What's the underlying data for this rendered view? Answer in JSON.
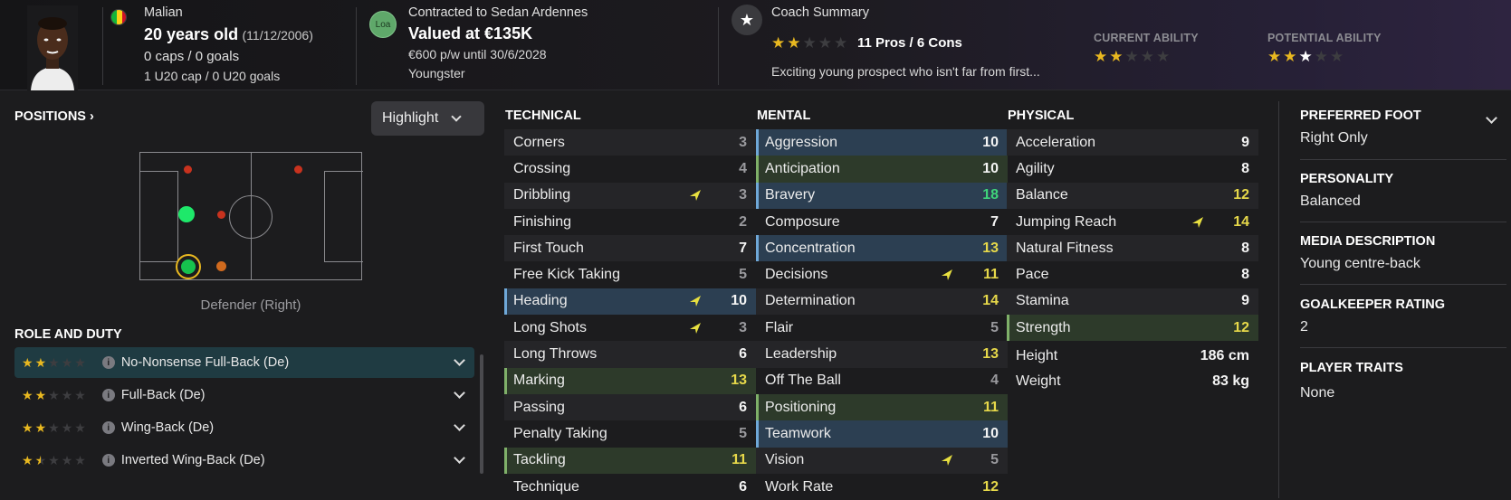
{
  "player": {
    "nationality": "Malian",
    "age": "20 years old",
    "dob": "(11/12/2006)",
    "caps": "0 caps / 0 goals",
    "u20": "1 U20 cap / 0 U20 goals"
  },
  "contract": {
    "club_badge": "Loa",
    "contracted_to": "Contracted to Sedan Ardennes",
    "value": "Valued at €135K",
    "wage": "€600 p/w until 30/6/2028",
    "status": "Youngster"
  },
  "coach": {
    "title": "Coach Summary",
    "pros_cons": "11 Pros / 6 Cons",
    "summary": "Exciting young prospect who isn't far from first...",
    "rating_stars": 2,
    "current_ability_label": "CURRENT ABILITY",
    "current_ability_stars": 2,
    "potential_ability_label": "POTENTIAL ABILITY",
    "potential_ability_stars": 3
  },
  "positions": {
    "title": "POSITIONS",
    "highlight_label": "Highlight",
    "position_name": "Defender (Right)"
  },
  "roles": {
    "title": "ROLE AND DUTY",
    "items": [
      {
        "label": "No-Nonsense Full-Back (De)",
        "stars": 2,
        "selected": true
      },
      {
        "label": "Full-Back (De)",
        "stars": 2,
        "selected": false
      },
      {
        "label": "Wing-Back (De)",
        "stars": 2,
        "selected": false
      },
      {
        "label": "Inverted Wing-Back (De)",
        "stars": 1.5,
        "selected": false
      }
    ]
  },
  "technical": {
    "title": "TECHNICAL",
    "rows": [
      {
        "name": "Corners",
        "value": "3",
        "tone": "grey"
      },
      {
        "name": "Crossing",
        "value": "4",
        "tone": "grey"
      },
      {
        "name": "Dribbling",
        "value": "3",
        "tone": "grey",
        "arrow": true
      },
      {
        "name": "Finishing",
        "value": "2",
        "tone": "grey"
      },
      {
        "name": "First Touch",
        "value": "7",
        "tone": "white"
      },
      {
        "name": "Free Kick Taking",
        "value": "5",
        "tone": "grey"
      },
      {
        "name": "Heading",
        "value": "10",
        "tone": "white",
        "hl": "blue",
        "arrow": true
      },
      {
        "name": "Long Shots",
        "value": "3",
        "tone": "grey",
        "arrow": true
      },
      {
        "name": "Long Throws",
        "value": "6",
        "tone": "white"
      },
      {
        "name": "Marking",
        "value": "13",
        "tone": "yellow",
        "hl": "green"
      },
      {
        "name": "Passing",
        "value": "6",
        "tone": "white"
      },
      {
        "name": "Penalty Taking",
        "value": "5",
        "tone": "grey"
      },
      {
        "name": "Tackling",
        "value": "11",
        "tone": "yellow",
        "hl": "green"
      },
      {
        "name": "Technique",
        "value": "6",
        "tone": "white"
      }
    ]
  },
  "mental": {
    "title": "MENTAL",
    "rows": [
      {
        "name": "Aggression",
        "value": "10",
        "tone": "white",
        "hl": "blue"
      },
      {
        "name": "Anticipation",
        "value": "10",
        "tone": "white",
        "hl": "green"
      },
      {
        "name": "Bravery",
        "value": "18",
        "tone": "green",
        "hl": "blue"
      },
      {
        "name": "Composure",
        "value": "7",
        "tone": "white"
      },
      {
        "name": "Concentration",
        "value": "13",
        "tone": "yellow",
        "hl": "blue"
      },
      {
        "name": "Decisions",
        "value": "11",
        "tone": "yellow",
        "arrow": true
      },
      {
        "name": "Determination",
        "value": "14",
        "tone": "yellow"
      },
      {
        "name": "Flair",
        "value": "5",
        "tone": "grey"
      },
      {
        "name": "Leadership",
        "value": "13",
        "tone": "yellow"
      },
      {
        "name": "Off The Ball",
        "value": "4",
        "tone": "grey"
      },
      {
        "name": "Positioning",
        "value": "11",
        "tone": "yellow",
        "hl": "green"
      },
      {
        "name": "Teamwork",
        "value": "10",
        "tone": "white",
        "hl": "blue"
      },
      {
        "name": "Vision",
        "value": "5",
        "tone": "grey",
        "arrow": true
      },
      {
        "name": "Work Rate",
        "value": "12",
        "tone": "yellow"
      }
    ]
  },
  "physical": {
    "title": "PHYSICAL",
    "rows": [
      {
        "name": "Acceleration",
        "value": "9",
        "tone": "white"
      },
      {
        "name": "Agility",
        "value": "8",
        "tone": "white"
      },
      {
        "name": "Balance",
        "value": "12",
        "tone": "yellow"
      },
      {
        "name": "Jumping Reach",
        "value": "14",
        "tone": "yellow",
        "arrow": true
      },
      {
        "name": "Natural Fitness",
        "value": "8",
        "tone": "white"
      },
      {
        "name": "Pace",
        "value": "8",
        "tone": "white"
      },
      {
        "name": "Stamina",
        "value": "9",
        "tone": "white"
      },
      {
        "name": "Strength",
        "value": "12",
        "tone": "yellow",
        "hl": "green"
      }
    ],
    "height_label": "Height",
    "height_value": "186 cm",
    "weight_label": "Weight",
    "weight_value": "83 kg"
  },
  "right_panel": {
    "preferred_foot_title": "PREFERRED FOOT",
    "preferred_foot_value": "Right Only",
    "personality_title": "PERSONALITY",
    "personality_value": "Balanced",
    "media_title": "MEDIA DESCRIPTION",
    "media_value": "Young centre-back",
    "gk_title": "GOALKEEPER RATING",
    "gk_value": "2",
    "traits_title": "PLAYER TRAITS",
    "traits_value": "None"
  },
  "colors": {
    "accent_blue": "#6fa8d8",
    "accent_green": "#7fb069",
    "star_gold": "#e8b820",
    "value_yellow": "#e6d84a",
    "value_green": "#3fd47a"
  }
}
